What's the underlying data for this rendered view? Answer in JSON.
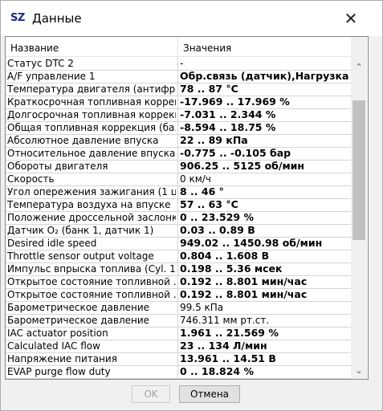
{
  "window": {
    "app_icon": "SZ",
    "title": "Данные",
    "close_glyph": "✕"
  },
  "table": {
    "columns": [
      "Название",
      "Значения"
    ],
    "rows": [
      {
        "name": "Статус DTC 2",
        "value": "-",
        "bold": false
      },
      {
        "name": "A/F управление 1",
        "value": "Обр.связь (датчик),Нагрузка ...",
        "bold": true
      },
      {
        "name": "Температура двигателя (антифр...",
        "value": "78 .. 87 °C",
        "bold": true
      },
      {
        "name": "Краткосрочная топливная коррек...",
        "value": "-17.969 .. 17.969 %",
        "bold": true
      },
      {
        "name": "Долгосрочная топливная коррекц...",
        "value": "-7.031 .. 2.344 %",
        "bold": true
      },
      {
        "name": "Общая топливная коррекция (ба...",
        "value": "-8.594 .. 18.75 %",
        "bold": true
      },
      {
        "name": "Абсолютное давление впуска",
        "value": "22 .. 89 кПа",
        "bold": true
      },
      {
        "name": "Относительное давление впуска",
        "value": "-0.775 .. -0.105 бар",
        "bold": true
      },
      {
        "name": "Обороты двигателя",
        "value": "906.25 .. 5125 об/мин",
        "bold": true
      },
      {
        "name": "Скорость",
        "value": "0 км/ч",
        "bold": false
      },
      {
        "name": "Угол опережения зажигания (1 ц...",
        "value": "8 .. 46 °",
        "bold": true
      },
      {
        "name": "Температура воздуха на впуске",
        "value": "57 .. 63 °C",
        "bold": true
      },
      {
        "name": "Положение дроссельной заслонки",
        "value": "0 .. 23.529 %",
        "bold": true
      },
      {
        "name": "Датчик O₂ (банк 1, датчик 1)",
        "value": "0.03 .. 0.89 В",
        "bold": true
      },
      {
        "name": "Desired idle speed",
        "value": "949.02 .. 1450.98 об/мин",
        "bold": true
      },
      {
        "name": "Throttle sensor output voltage",
        "value": "0.804 .. 1.608 В",
        "bold": true
      },
      {
        "name": "Импульс впрыска топлива (Cyl. 1,...",
        "value": "0.198 .. 5.36 мсек",
        "bold": true
      },
      {
        "name": "Открытое состояние топливной ...",
        "value": "0.192 .. 8.801 мин/час",
        "bold": true
      },
      {
        "name": "Открытое состояние топливной ...",
        "value": "0.192 .. 8.801 мин/час",
        "bold": true
      },
      {
        "name": "Барометрическое давление",
        "value": "99.5 кПа",
        "bold": false
      },
      {
        "name": "Барометрическое давление",
        "value": "746.311 мм рт.ст.",
        "bold": false
      },
      {
        "name": "IAC actuator position",
        "value": "1.961 .. 21.569 %",
        "bold": true
      },
      {
        "name": "Calculated IAC flow",
        "value": "23 .. 134 Л/мин",
        "bold": true
      },
      {
        "name": "Напряжение питания",
        "value": "13.961 .. 14.51 В",
        "bold": true
      },
      {
        "name": "EVAP purge flow duty",
        "value": "0 .. 18.824 %",
        "bold": true
      }
    ]
  },
  "scrollbar": {
    "up_glyph": "⌃",
    "down_glyph": "⌄"
  },
  "buttons": {
    "ok": "OK",
    "cancel": "Отмена"
  }
}
